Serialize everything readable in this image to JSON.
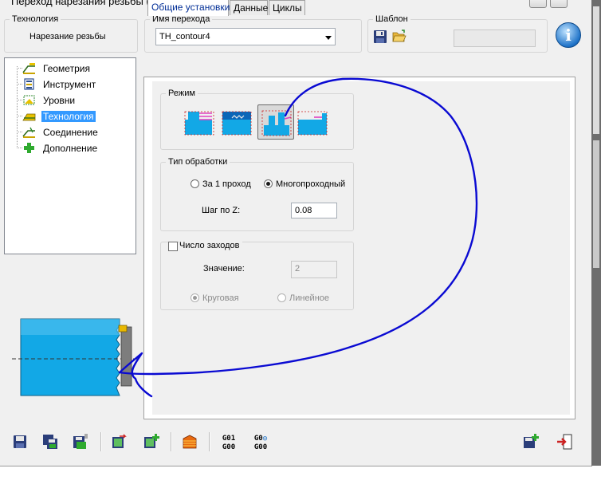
{
  "window": {
    "title": "Переход нарезания резьбы (токарный)"
  },
  "technology": {
    "legend": "Технология",
    "value": "Нарезание резьбы"
  },
  "transition_name": {
    "legend": "Имя перехода",
    "value": "TH_contour4"
  },
  "template": {
    "legend": "Шаблон",
    "save_icon": "save-icon",
    "open_icon": "open-folder-icon",
    "field_value": ""
  },
  "info_button": {
    "label": "i"
  },
  "tree": {
    "items": [
      {
        "label": "Геометрия",
        "icon": "geometry-icon"
      },
      {
        "label": "Инструмент",
        "icon": "tool-icon"
      },
      {
        "label": "Уровни",
        "icon": "levels-icon"
      },
      {
        "label": "Технология",
        "icon": "technology-icon",
        "selected": true
      },
      {
        "label": "Соединение",
        "icon": "connection-icon"
      },
      {
        "label": "Дополнение",
        "icon": "plus-icon"
      }
    ]
  },
  "tabs": [
    {
      "label": "Общие установки",
      "active": true
    },
    {
      "label": "Данные"
    },
    {
      "label": "Циклы"
    }
  ],
  "mode": {
    "legend": "Режим",
    "selected_index": 2
  },
  "processing": {
    "legend": "Тип обработки",
    "option_single": "За 1 проход",
    "option_multi": "Многопроходный",
    "selected": "multi",
    "step_label": "Шаг по Z:",
    "step_value": "0.08"
  },
  "starts": {
    "checkbox_label": "Число заходов",
    "checked": false,
    "value_label": "Значение:",
    "value": "2",
    "option_circular": "Круговая",
    "option_linear": "Линейное",
    "selected": "circular"
  },
  "toolbar": {
    "gcode1": [
      "G01",
      "G00"
    ],
    "gcode2": [
      "G0",
      "G00"
    ]
  },
  "colors": {
    "accent": "#3399ff",
    "tab_active_text": "#002d96",
    "annotation_stroke": "#0a0ad2",
    "part_fill": "#12a8e6"
  }
}
